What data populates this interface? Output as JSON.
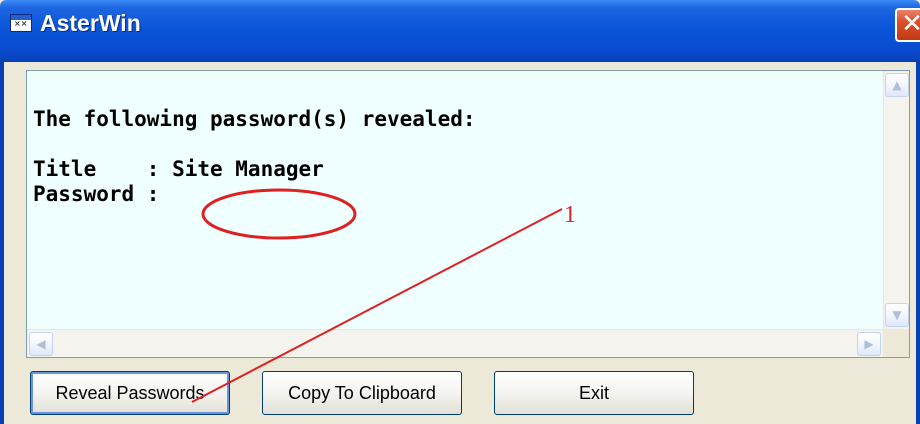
{
  "window": {
    "title": "AsterWin",
    "close_glyph": "✕",
    "accent_color": "#0a55da",
    "close_color": "#d9502a"
  },
  "output": {
    "lines": [
      "The following password(s) revealed:",
      "",
      "Title    : Site Manager",
      "Password : "
    ],
    "background_color": "#f0ffff"
  },
  "scrollbar": {
    "up_glyph": "▲",
    "down_glyph": "▼",
    "left_glyph": "◀",
    "right_glyph": "▶"
  },
  "annotation": {
    "label": "1",
    "color": "#e02020"
  },
  "buttons": {
    "reveal": "Reveal Passwords",
    "copy": "Copy To Clipboard",
    "exit": "Exit"
  }
}
